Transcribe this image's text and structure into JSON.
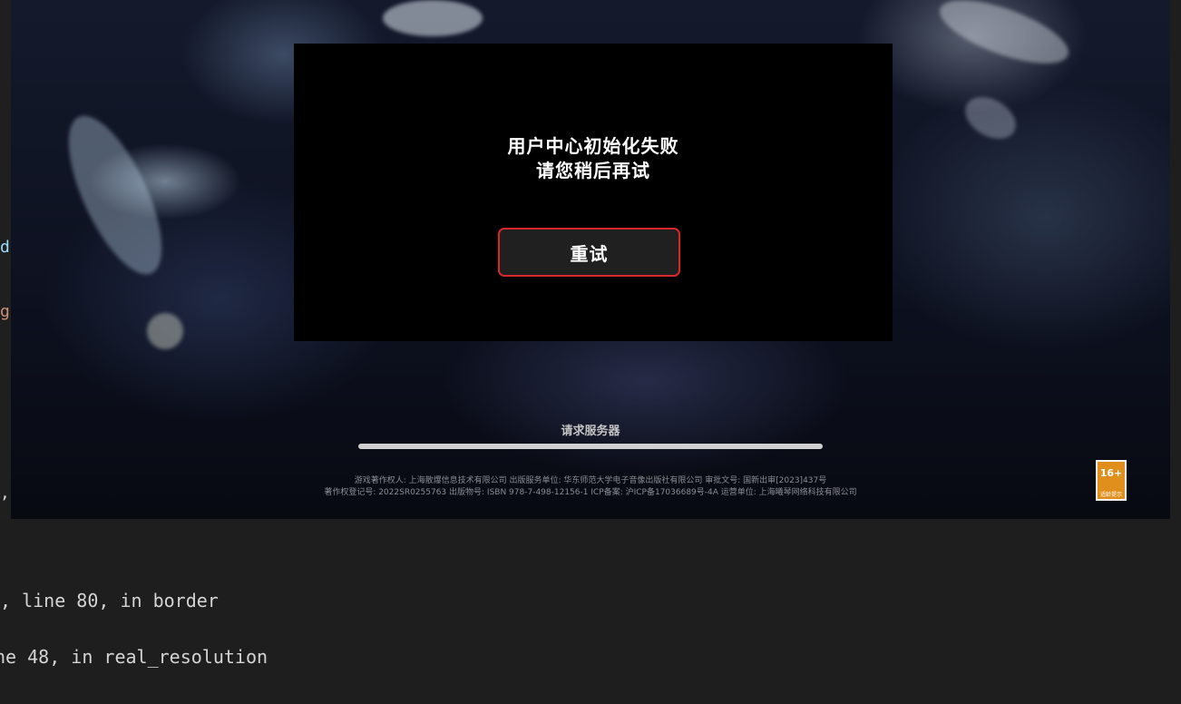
{
  "editor_edge": {
    "fragments": [
      {
        "text": "d",
        "color": "#9cdcfe"
      },
      {
        "text": "g",
        "color": "#ce9178"
      },
      {
        "text": ",",
        "color": "#d4d4d4"
      }
    ]
  },
  "dialog": {
    "line1": "用户中心初始化失败",
    "line2": "请您稍后再试",
    "retry_label": "重试"
  },
  "loading": {
    "label": "请求服务器",
    "progress_fraction": 1.0
  },
  "legal": {
    "line1": "游戏著作权人: 上海散爆信息技术有限公司  出版服务单位: 华东师范大学电子音像出版社有限公司  审批文号: 国新出审[2023]437号",
    "line2": "著作权登记号: 2022SR0255763  出版物号: ISBN 978-7-498-12156-1  ICP备案: 沪ICP备17036689号-4A  运营单位: 上海曦琴网络科技有限公司"
  },
  "age_badge": {
    "number": "16+",
    "caption": "适龄提示"
  },
  "terminal": {
    "lines": [
      ", line 80, in border",
      "ne 48, in real_resolution"
    ]
  },
  "colors": {
    "retry_border": "#d9262b",
    "dialog_bg": "#000000",
    "age_badge": "#e08e1c",
    "terminal_bg": "#1e1e1e"
  }
}
